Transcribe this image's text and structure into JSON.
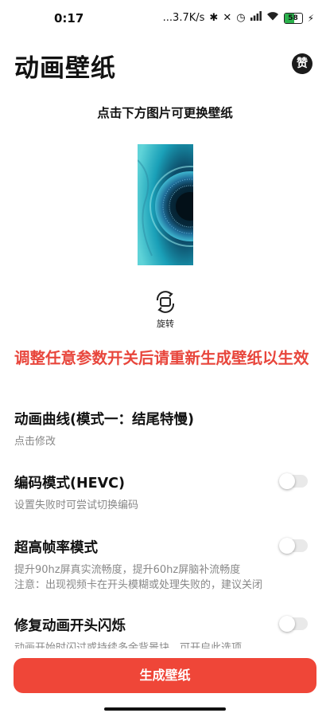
{
  "status_bar": {
    "time": "0:17",
    "net_speed": "...3.7K/s",
    "battery": "58"
  },
  "header": {
    "title": "动画壁纸",
    "like_label": "赞"
  },
  "tip": "点击下方图片可更换壁纸",
  "rotate": {
    "label": "旋转"
  },
  "warning": "调整任意参数开关后请重新生成壁纸以生效",
  "settings": [
    {
      "title": "动画曲线(模式一：结尾特慢)",
      "subtitle": "点击修改"
    },
    {
      "title": "编码模式(HEVC)",
      "subtitle": "设置失败时可尝试切换编码",
      "toggle_on": false
    },
    {
      "title": "超高帧率模式",
      "subtitle": "提升90hz屏真实流畅度，提升60hz屏脑补流畅度",
      "subtitle2": "注意：出现视频卡在开头模糊或处理失败的，建议关闭",
      "toggle_on": false
    },
    {
      "title": "修复动画开头闪烁",
      "subtitle": "动画开始时闪过或持续多余背景块，可开启此选项",
      "toggle_on": false
    }
  ],
  "generate_button": "生成壁纸",
  "colors": {
    "accent": "#ef4638",
    "warning": "#e8463c",
    "subtle_text": "#888888"
  }
}
